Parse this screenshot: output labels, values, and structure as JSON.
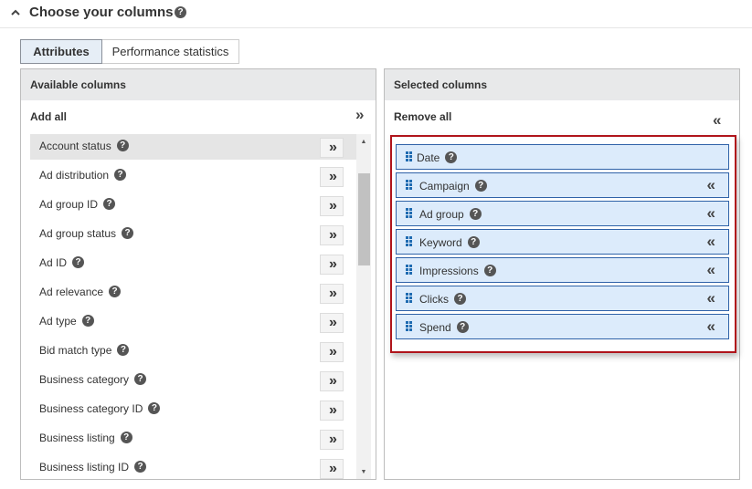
{
  "section": {
    "title": "Choose your columns",
    "help": "?"
  },
  "tabs": [
    {
      "label": "Attributes",
      "active": true
    },
    {
      "label": "Performance statistics",
      "active": false
    }
  ],
  "available": {
    "heading": "Available columns",
    "bulk_label": "Add all",
    "bulk_icon": "»",
    "add_icon": "»",
    "items": [
      {
        "label": "Account status"
      },
      {
        "label": "Ad distribution"
      },
      {
        "label": "Ad group ID"
      },
      {
        "label": "Ad group status"
      },
      {
        "label": "Ad ID"
      },
      {
        "label": "Ad relevance"
      },
      {
        "label": "Ad type"
      },
      {
        "label": "Bid match type"
      },
      {
        "label": "Business category"
      },
      {
        "label": "Business category ID"
      },
      {
        "label": "Business listing"
      },
      {
        "label": "Business listing ID"
      }
    ],
    "scroll_up": "▲",
    "scroll_down": "▼"
  },
  "selected": {
    "heading": "Selected columns",
    "bulk_label": "Remove all",
    "bulk_icon": "«",
    "remove_icon": "«",
    "items": [
      {
        "label": "Date",
        "removable": false
      },
      {
        "label": "Campaign",
        "removable": true
      },
      {
        "label": "Ad group",
        "removable": true
      },
      {
        "label": "Keyword",
        "removable": true
      },
      {
        "label": "Impressions",
        "removable": true
      },
      {
        "label": "Clicks",
        "removable": true
      },
      {
        "label": "Spend",
        "removable": true
      }
    ]
  },
  "colors": {
    "accent_border": "#2f62a8",
    "selected_bg": "#dcebfb",
    "highlight_box": "#b0141b",
    "header_bg": "#e8e9ea",
    "active_tab_bg": "#e6eef6"
  }
}
